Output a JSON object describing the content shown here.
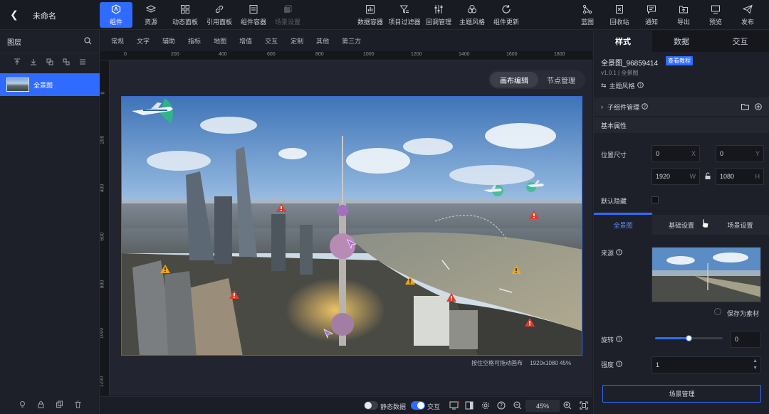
{
  "header": {
    "title": "未命名",
    "left_buttons": [
      {
        "label": "组件",
        "icon": "component-icon",
        "active": true
      },
      {
        "label": "资源",
        "icon": "layers-icon"
      },
      {
        "label": "动态面板",
        "icon": "grid-icon"
      },
      {
        "label": "引用面板",
        "icon": "link-icon"
      },
      {
        "label": "组件容器",
        "icon": "container-icon"
      },
      {
        "label": "场景设置",
        "icon": "copy-icon",
        "disabled": true
      }
    ],
    "mid_buttons": [
      {
        "label": "数据容器",
        "icon": "chart-icon"
      },
      {
        "label": "项目过滤器",
        "icon": "filter-icon"
      },
      {
        "label": "回调管理",
        "icon": "sliders-icon"
      },
      {
        "label": "主题风格",
        "icon": "palette-icon"
      },
      {
        "label": "组件更新",
        "icon": "refresh-icon"
      }
    ],
    "right_buttons": [
      {
        "label": "蓝图",
        "icon": "blueprint-icon"
      },
      {
        "label": "回收站",
        "icon": "trash-icon"
      },
      {
        "label": "通知",
        "icon": "message-icon"
      },
      {
        "label": "导出",
        "icon": "export-icon"
      },
      {
        "label": "预览",
        "icon": "monitor-icon"
      },
      {
        "label": "发布",
        "icon": "send-icon"
      }
    ]
  },
  "layers": {
    "title": "图层",
    "item_label": "全景图"
  },
  "categories": [
    "常规",
    "文字",
    "辅助",
    "指标",
    "地图",
    "增值",
    "交互",
    "定制",
    "其他",
    "第三方"
  ],
  "ruler": {
    "h": [
      "0",
      "200",
      "400",
      "600",
      "800",
      "1000",
      "1200",
      "1400",
      "1600",
      "1800"
    ],
    "v": [
      "0",
      "200",
      "400",
      "600",
      "800",
      "1000",
      "1200"
    ]
  },
  "canvas": {
    "toggle_on": "画布编辑",
    "toggle_off": "节点管理",
    "hint": "按住空格可拖动画布",
    "size_info": "1920x1080 45%"
  },
  "bottom": {
    "static_data": "静态数据",
    "interact": "交互",
    "zoom": "45%"
  },
  "panel": {
    "tabs": [
      "样式",
      "数据",
      "交互"
    ],
    "component_name": "全景图_96859414",
    "tutorial_btn": "查看教程",
    "version": "v1.0.1 | 全景图",
    "theme_style": "主题风格",
    "sub_manage": "子组件管理",
    "basic_props": "基本属性",
    "pos_size_label": "位置尺寸",
    "x_value": "0",
    "x_suffix": "X",
    "y_value": "0",
    "y_suffix": "Y",
    "w_value": "1920",
    "w_suffix": "W",
    "h_value": "1080",
    "h_suffix": "H",
    "hide_label": "默认隐藏",
    "subtabs": [
      "全景图",
      "基础设置",
      "场景设置"
    ],
    "source_label": "来源",
    "save_material": "保存为素材",
    "rotate_label": "旋转",
    "rotate_value": "0",
    "intensity_label": "强度",
    "intensity_value": "1",
    "scene_manage": "场景管理"
  }
}
